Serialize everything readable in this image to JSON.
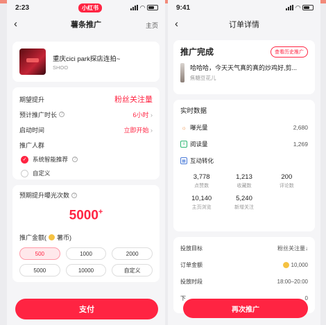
{
  "left": {
    "status": {
      "time": "2:23",
      "app_badge": "小红书"
    },
    "nav": {
      "title": "薯条推广",
      "right_link": "主页"
    },
    "post": {
      "title": "重庆cici park探店连拍~",
      "author": "SHOO"
    },
    "settings": {
      "goal_label": "期望提升",
      "goal_value": "粉丝关注量",
      "duration_label": "预计推广时长",
      "duration_value": "6小时",
      "start_label": "启动时间",
      "start_value": "立即开始",
      "audience_label": "推广人群",
      "audience_options": [
        {
          "label": "系统智能推荐",
          "selected": true
        },
        {
          "label": "自定义",
          "selected": false
        }
      ]
    },
    "budget": {
      "exposure_label": "预期提升曝光次数",
      "exposure_value": "5000",
      "exposure_suffix": "+",
      "amount_label": "推广金额(",
      "amount_unit": "薯币)",
      "amounts": [
        "500",
        "1000",
        "2000",
        "5000",
        "10000",
        "自定义"
      ],
      "selected_index": 0
    },
    "pay_label": "支付"
  },
  "right": {
    "status": {
      "time": "9:41"
    },
    "nav": {
      "title": "订单详情"
    },
    "summary": {
      "status": "推广完成",
      "history_button": "查看历史推广",
      "note_text": "哈哈哈，今天天气真的真的炒鸡好,剪...",
      "author": "焦糖豆花儿"
    },
    "realtime": {
      "title": "实时数据",
      "exposure_label": "曝光量",
      "exposure_value": "2,680",
      "read_label": "阅读量",
      "read_value": "1,269",
      "interaction_label": "互动转化",
      "stats": [
        {
          "value": "3,778",
          "label": "点赞数"
        },
        {
          "value": "1,213",
          "label": "收藏数"
        },
        {
          "value": "200",
          "label": "评论数"
        },
        {
          "value": "10,140",
          "label": "主页浏览"
        },
        {
          "value": "5,240",
          "label": "新增关注"
        }
      ]
    },
    "order": {
      "rows": [
        {
          "label": "投放目标",
          "value": "粉丝关注量↓"
        },
        {
          "label": "订单金额",
          "value": "10,000",
          "coin": true
        },
        {
          "label": "投放时段",
          "value": "18:00–20:00"
        },
        {
          "label": "下",
          "value": "0"
        }
      ]
    },
    "promote_label": "再次推广"
  },
  "colors": {
    "brand": "#ff2442",
    "topstrip": "#f28a7a"
  },
  "icons": [
    "back-chevron-icon",
    "sun-icon",
    "doc-icon",
    "calendar-icon",
    "coin-icon",
    "question-icon",
    "check-icon",
    "wifi-icon",
    "battery-icon",
    "signal-icon"
  ]
}
